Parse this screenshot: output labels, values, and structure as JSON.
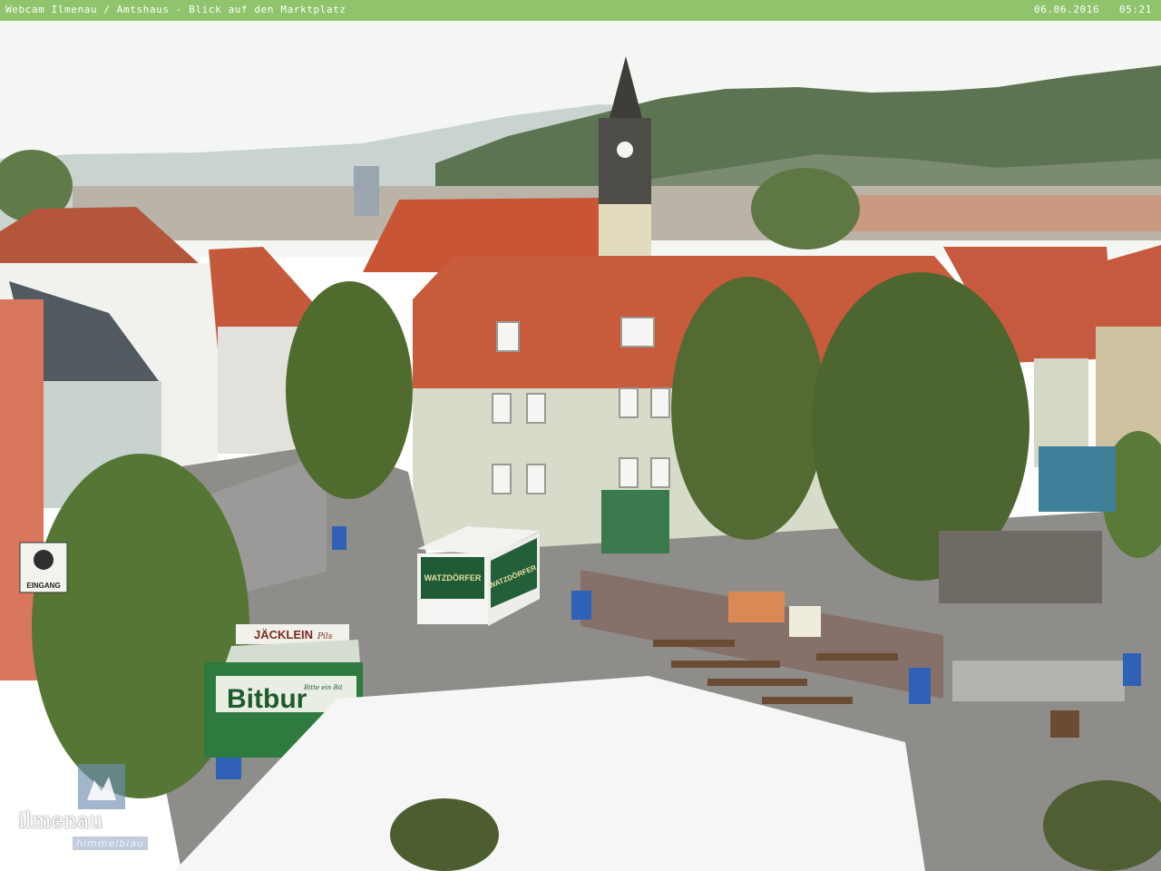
{
  "header": {
    "title": "Webcam Ilmenau / Amtshaus - Blick auf den Marktplatz",
    "datetime": "06.06.2016   05:21"
  },
  "scene": {
    "signs": {
      "trailer_brand": "WATZDÖRFER",
      "trailer_brand_side": "WATZDÖRFER",
      "stall_name": "JÄCKLEIN",
      "stall_suffix": "Pils",
      "stall_beer": "Bitbur",
      "stall_tagline": "Bitte ein Bit",
      "eingang": "EINGANG"
    }
  },
  "watermark": {
    "town": "ilmenau",
    "subtitle": "himmelblau"
  },
  "colors": {
    "header_bg": "#8fc46d",
    "sky": "#f3f5f2",
    "roof": "#c8593a",
    "facade": "#d8decb",
    "tree": "#4f6b2e",
    "pavement": "#8e8d8b"
  }
}
